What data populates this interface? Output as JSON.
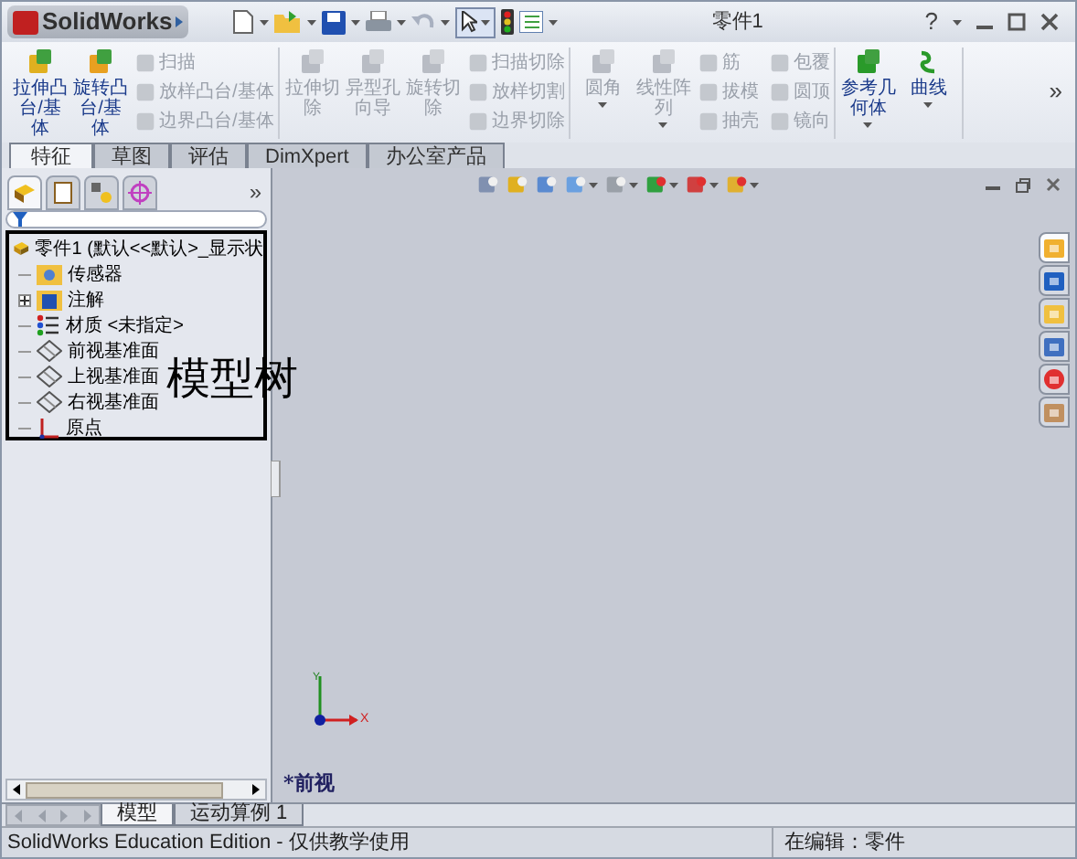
{
  "title_bar": {
    "app_name": "SolidWorks",
    "title": "零件1",
    "help": "?"
  },
  "ribbon": {
    "groups": [
      {
        "large": [
          {
            "label": "拉伸凸台/基体",
            "kind": "extrude",
            "disabled": false
          },
          {
            "label": "旋转凸台/基体",
            "kind": "revolve",
            "disabled": false
          }
        ],
        "small": [
          {
            "label": "扫描",
            "disabled": true
          },
          {
            "label": "放样凸台/基体",
            "disabled": true
          },
          {
            "label": "边界凸台/基体",
            "disabled": true
          }
        ]
      },
      {
        "large": [
          {
            "label": "拉伸切除",
            "kind": "cut",
            "disabled": true
          },
          {
            "label": "异型孔向导",
            "kind": "hole",
            "disabled": true
          },
          {
            "label": "旋转切除",
            "kind": "cut",
            "disabled": true
          }
        ],
        "small": [
          {
            "label": "扫描切除",
            "disabled": true
          },
          {
            "label": "放样切割",
            "disabled": true
          },
          {
            "label": "边界切除",
            "disabled": true
          }
        ]
      },
      {
        "large": [
          {
            "label": "圆角",
            "kind": "fillet",
            "disabled": true
          },
          {
            "label": "线性阵列",
            "kind": "pattern",
            "disabled": true
          }
        ],
        "small": [
          {
            "label": "筋",
            "disabled": true
          },
          {
            "label": "拔模",
            "disabled": true
          },
          {
            "label": "抽壳",
            "disabled": true
          },
          {
            "label": "包覆",
            "disabled": true
          },
          {
            "label": "圆顶",
            "disabled": true
          },
          {
            "label": "镜向",
            "disabled": true
          }
        ]
      },
      {
        "large": [
          {
            "label": "参考几何体",
            "kind": "reference",
            "disabled": false
          },
          {
            "label": "曲线",
            "kind": "curve",
            "disabled": false
          }
        ]
      }
    ],
    "more": "»"
  },
  "tabs": [
    {
      "label": "特征",
      "selected": true
    },
    {
      "label": "草图",
      "selected": false
    },
    {
      "label": "评估",
      "selected": false
    },
    {
      "label": "DimXpert",
      "selected": false
    },
    {
      "label": "办公室产品",
      "selected": false
    }
  ],
  "panel": {
    "tabs": [
      {
        "kind": "tree",
        "selected": true
      },
      {
        "kind": "property",
        "selected": false
      },
      {
        "kind": "config",
        "selected": false
      },
      {
        "kind": "target",
        "selected": false
      }
    ],
    "more": "»",
    "tree": [
      {
        "label": "零件1 (默认<<默认>_显示状",
        "kind": "part",
        "children": [
          {
            "label": "传感器",
            "kind": "sensor"
          },
          {
            "label": "注解",
            "kind": "annotation",
            "expanded": false
          },
          {
            "label": "材质 <未指定>",
            "kind": "material"
          },
          {
            "label": "前视基准面",
            "kind": "plane"
          },
          {
            "label": "上视基准面",
            "kind": "plane"
          },
          {
            "label": "右视基准面",
            "kind": "plane"
          },
          {
            "label": "原点",
            "kind": "origin"
          }
        ]
      }
    ],
    "callout": "模型树"
  },
  "viewport": {
    "view_name": "*前视",
    "axes": {
      "x": "X",
      "y": "Y"
    },
    "task_pane": [
      {
        "kind": "home",
        "selected": true
      },
      {
        "kind": "library",
        "selected": false
      },
      {
        "kind": "folder",
        "selected": false
      },
      {
        "kind": "palette",
        "selected": false
      },
      {
        "kind": "appearance",
        "selected": false
      },
      {
        "kind": "custom",
        "selected": false
      }
    ]
  },
  "bottom_tabs": [
    {
      "label": "模型",
      "selected": true
    },
    {
      "label": "运动算例 1",
      "selected": false
    }
  ],
  "status_bar": {
    "text": "SolidWorks Education Edition - 仅供教学使用",
    "state": "在编辑：零件"
  }
}
